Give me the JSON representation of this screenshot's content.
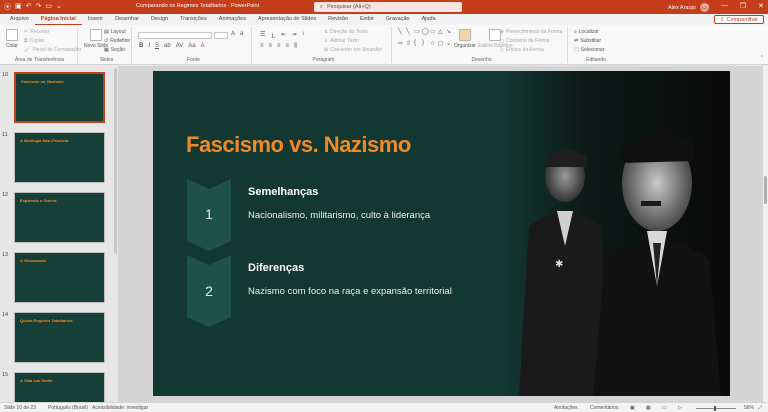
{
  "titlebar": {
    "file_title": "Comparando os Regimes Totalitarios  ·  PowerPoint",
    "search_placeholder": "Pesquisar (Alt+Q)",
    "user_name": "Alex Araujo",
    "user_initials": "AA"
  },
  "tabs": [
    "Arquivo",
    "Página Inicial",
    "Inserir",
    "Desenhar",
    "Design",
    "Transições",
    "Animações",
    "Apresentação de Slides",
    "Revisão",
    "Exibir",
    "Gravação",
    "Ajuda"
  ],
  "active_tab": "Página Inicial",
  "share_label": "Compartilhar",
  "ribbon": {
    "clipboard": {
      "label": "Área de Transferência",
      "paste": "Colar",
      "cut": "Recortar",
      "copy": "Copiar",
      "format_painter": "Pincel de Formatação"
    },
    "slides": {
      "label": "Slides",
      "new_slide": "Novo Slide",
      "layout": "Layout",
      "reset": "Redefinir",
      "section": "Seção"
    },
    "font": {
      "label": "Fonte"
    },
    "paragraph": {
      "label": "Parágrafo",
      "text_direction": "Direção do Texto",
      "align_text": "Alinhar Texto",
      "smartart": "Converter em SmartArt"
    },
    "drawing": {
      "label": "Desenho",
      "arrange": "Organizar",
      "quick_styles": "Estilos Rápidos",
      "shape_fill": "Preenchimento da Forma",
      "shape_outline": "Contorno da Forma",
      "shape_effects": "Efeitos da Forma"
    },
    "editing": {
      "label": "Editando",
      "find": "Localizar",
      "replace": "Substituir",
      "select": "Selecionar"
    }
  },
  "thumbnails": [
    {
      "num": "10",
      "title": "Fascismo vs. Nazismo",
      "active": true
    },
    {
      "num": "11",
      "title": "A Ideologia Nazi-Fascista"
    },
    {
      "num": "12",
      "title": "Expansão e Guerra"
    },
    {
      "num": "13",
      "title": "O Holocausto"
    },
    {
      "num": "14",
      "title": "Queda Regimes Totalitários"
    },
    {
      "num": "15",
      "title": "A Vida sob Stalin"
    }
  ],
  "slide": {
    "title": "Fascismo vs. Nazismo",
    "items": [
      {
        "number": "1",
        "heading": "Semelhanças",
        "text": "Nacionalismo, militarismo, culto à liderança"
      },
      {
        "number": "2",
        "heading": "Diferenças",
        "text": "Nazismo com foco na raça e expansão territorial"
      }
    ]
  },
  "status": {
    "slide_pos": "Slide 10 de 23",
    "language": "Português (Brasil)",
    "accessibility": "Acessibilidade: investigar",
    "notes": "Anotações",
    "comments": "Comentários",
    "zoom": "56%"
  },
  "colors": {
    "brand": "#c43e1c",
    "slide_bg": "#133832",
    "title_orange": "#f08a24",
    "chevron": "#1e5149"
  }
}
